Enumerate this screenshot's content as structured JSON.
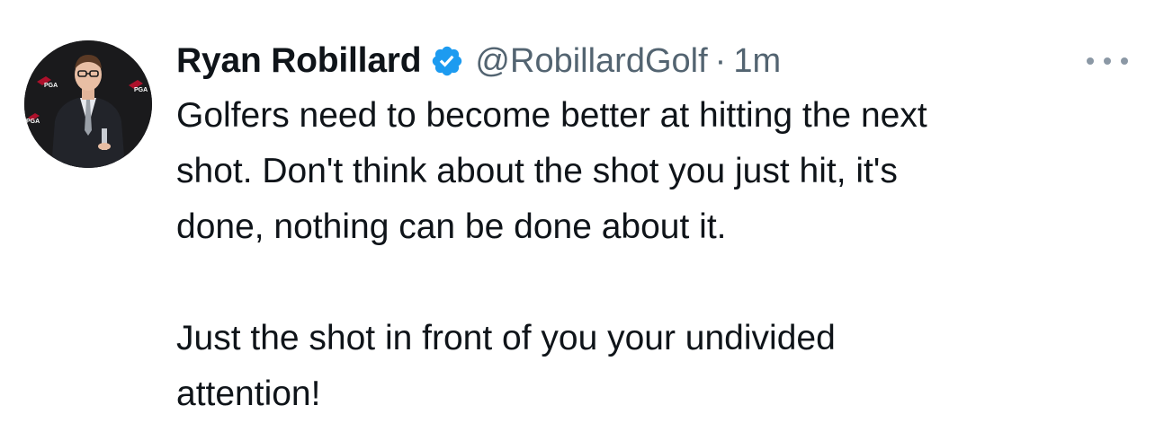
{
  "author": {
    "name": "Ryan Robillard",
    "handle": "@RobillardGolf",
    "separator": "·",
    "time": "1m",
    "verified": true,
    "verified_color": "#1d9bf0"
  },
  "avatar": {
    "icon": "profile-photo",
    "logo_text": "PGA"
  },
  "tweet": {
    "lines": [
      "Golfers need to become better at hitting the next",
      "shot. Don't think about the shot you just hit, it's",
      "done, nothing can be done about it."
    ],
    "lines2": [
      "Just the shot in front of you your undivided",
      "attention!"
    ]
  },
  "more_icon": "more-options-icon"
}
